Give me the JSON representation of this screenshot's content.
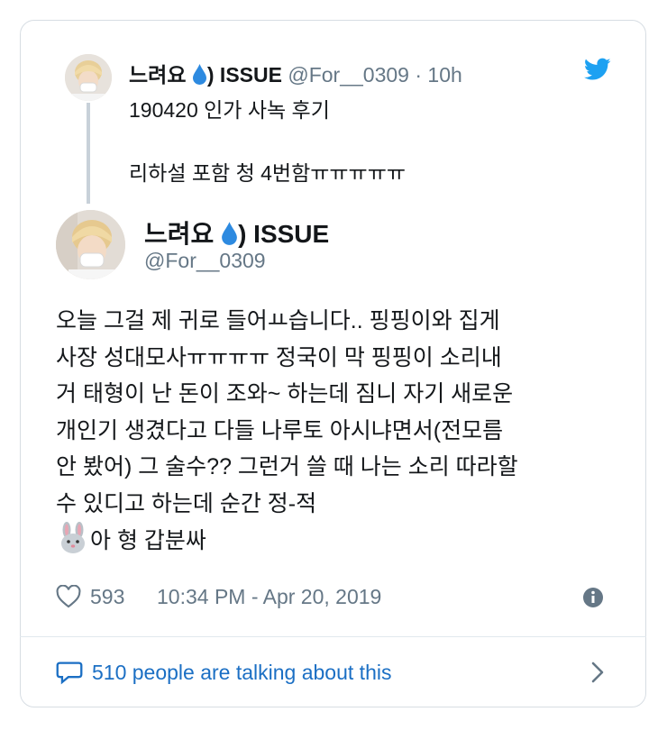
{
  "quoted_tweet": {
    "name": "느려요",
    "name_suffix": ") ISSUE",
    "handle": "@For__0309",
    "separator": "·",
    "time": "10h",
    "line1": "190420 인가 사녹 후기",
    "line2": "리하설 포함 청 4번함ㅠㅠㅠㅠㅠ"
  },
  "main_tweet": {
    "name": "느려요",
    "name_suffix": ") ISSUE",
    "handle": "@For__0309",
    "body_lines": [
      "오늘 그걸 제 귀로 들어ㅛ습니다.. 핑핑이와 집게",
      "사장 성대모사ㅠㅠㅠㅠ 정국이 막 핑핑이 소리내",
      "거 태형이 난 돈이 조와~ 하는데 짐니 자기 새로운",
      "개인기 생겼다고 다들 나루토 아시냐면서(전모름",
      "안 봤어) 그 술수?? 그런거 쓸 때 나는 소리 따라할",
      "수 있디고 하는데 순간 정-적"
    ],
    "last_line": "아 형 갑분싸",
    "emoji_icon": "rabbit-face-icon",
    "likes": "593",
    "timestamp": "10:34 PM - Apr 20, 2019"
  },
  "footer": {
    "talking": "510 people are talking about this"
  },
  "colors": {
    "twitter_blue": "#1da1f2",
    "link_blue": "#1b6fc4",
    "secondary_text": "#657786",
    "drop_blue": "#2d8ae0"
  }
}
